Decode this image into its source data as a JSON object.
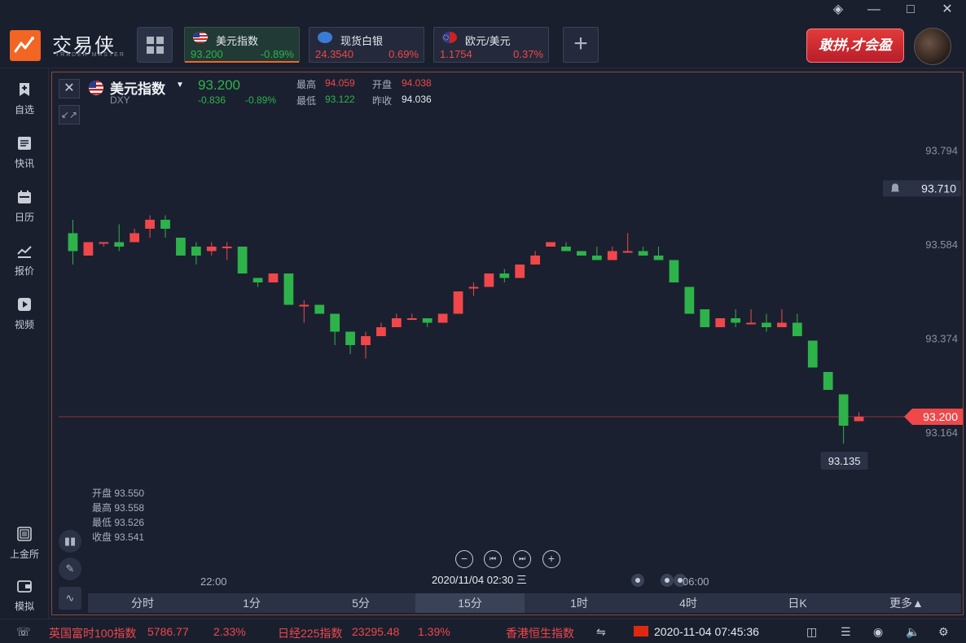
{
  "header": {
    "brand": "交易侠",
    "brand_sub": "TRADER MASTER",
    "promo": "敢拼,才会盈",
    "window_controls": [
      "layers-icon",
      "minimize-icon",
      "maximize-icon",
      "close-icon"
    ]
  },
  "tickers": [
    {
      "name": "美元指数",
      "price": "93.200",
      "change": "-0.89%",
      "direction": "down",
      "active": true
    },
    {
      "name": "现货白银",
      "price": "24.3540",
      "change": "0.69%",
      "direction": "up",
      "active": false
    },
    {
      "name": "欧元/美元",
      "price": "1.1754",
      "change": "0.37%",
      "direction": "up",
      "active": false
    }
  ],
  "sidebar": {
    "items": [
      {
        "label": "自选",
        "icon": "bookmark-plus-icon"
      },
      {
        "label": "快讯",
        "icon": "news-icon"
      },
      {
        "label": "日历",
        "icon": "calendar-icon"
      },
      {
        "label": "报价",
        "icon": "quote-chart-icon"
      },
      {
        "label": "视频",
        "icon": "video-icon"
      }
    ],
    "bottom_items": [
      {
        "label": "上金所",
        "icon": "sge-icon"
      },
      {
        "label": "模拟",
        "icon": "wallet-icon"
      }
    ]
  },
  "symbol": {
    "name": "美元指数",
    "code": "DXY",
    "price": "93.200",
    "change": "-0.836",
    "change_pct": "-0.89%",
    "high_label": "最高",
    "high": "94.059",
    "open_label": "开盘",
    "open": "94.038",
    "low_label": "最低",
    "low": "93.122",
    "prev_label": "昨收",
    "prev_close": "94.036"
  },
  "ohlc_hover": {
    "open": "开盘 93.550",
    "high": "最高 93.558",
    "low": "最低 93.526",
    "close": "收盘 93.541"
  },
  "colors": {
    "up": "#f0474a",
    "down": "#2db34a",
    "accent": "#f26522"
  },
  "chart_data": {
    "type": "candlestick",
    "y_axis_ticks": [
      "93.794",
      "93.584",
      "93.374",
      "93.164"
    ],
    "alert_price": "93.710",
    "last_price": "93.200",
    "low_marker": "93.135",
    "ylim": [
      93.06,
      93.86
    ],
    "x_labels": [
      "22:00",
      "06:00"
    ],
    "cursor_time": "2020/11/04 02:30 三",
    "candles": [
      {
        "o": 93.61,
        "h": 93.64,
        "l": 93.54,
        "c": 93.57
      },
      {
        "o": 93.56,
        "h": 93.59,
        "l": 93.56,
        "c": 93.59
      },
      {
        "o": 93.59,
        "h": 93.59,
        "l": 93.58,
        "c": 93.59
      },
      {
        "o": 93.59,
        "h": 93.63,
        "l": 93.57,
        "c": 93.58
      },
      {
        "o": 93.59,
        "h": 93.62,
        "l": 93.59,
        "c": 93.61
      },
      {
        "o": 93.62,
        "h": 93.65,
        "l": 93.6,
        "c": 93.64
      },
      {
        "o": 93.64,
        "h": 93.65,
        "l": 93.6,
        "c": 93.62
      },
      {
        "o": 93.6,
        "h": 93.6,
        "l": 93.56,
        "c": 93.56
      },
      {
        "o": 93.58,
        "h": 93.59,
        "l": 93.54,
        "c": 93.56
      },
      {
        "o": 93.57,
        "h": 93.59,
        "l": 93.56,
        "c": 93.58
      },
      {
        "o": 93.58,
        "h": 93.59,
        "l": 93.55,
        "c": 93.58
      },
      {
        "o": 93.58,
        "h": 93.58,
        "l": 93.52,
        "c": 93.52
      },
      {
        "o": 93.51,
        "h": 93.51,
        "l": 93.49,
        "c": 93.5
      },
      {
        "o": 93.5,
        "h": 93.52,
        "l": 93.5,
        "c": 93.52
      },
      {
        "o": 93.52,
        "h": 93.52,
        "l": 93.45,
        "c": 93.45
      },
      {
        "o": 93.45,
        "h": 93.46,
        "l": 93.41,
        "c": 93.45
      },
      {
        "o": 93.45,
        "h": 93.45,
        "l": 93.43,
        "c": 93.43
      },
      {
        "o": 93.43,
        "h": 93.43,
        "l": 93.36,
        "c": 93.39
      },
      {
        "o": 93.39,
        "h": 93.39,
        "l": 93.34,
        "c": 93.36
      },
      {
        "o": 93.36,
        "h": 93.39,
        "l": 93.33,
        "c": 93.38
      },
      {
        "o": 93.38,
        "h": 93.41,
        "l": 93.38,
        "c": 93.4
      },
      {
        "o": 93.4,
        "h": 93.43,
        "l": 93.4,
        "c": 93.42
      },
      {
        "o": 93.42,
        "h": 93.43,
        "l": 93.42,
        "c": 93.42
      },
      {
        "o": 93.42,
        "h": 93.42,
        "l": 93.4,
        "c": 93.41
      },
      {
        "o": 93.41,
        "h": 93.43,
        "l": 93.41,
        "c": 93.43
      },
      {
        "o": 93.43,
        "h": 93.48,
        "l": 93.43,
        "c": 93.48
      },
      {
        "o": 93.49,
        "h": 93.5,
        "l": 93.47,
        "c": 93.49
      },
      {
        "o": 93.49,
        "h": 93.52,
        "l": 93.49,
        "c": 93.52
      },
      {
        "o": 93.52,
        "h": 93.53,
        "l": 93.5,
        "c": 93.51
      },
      {
        "o": 93.51,
        "h": 93.54,
        "l": 93.51,
        "c": 93.54
      },
      {
        "o": 93.54,
        "h": 93.57,
        "l": 93.54,
        "c": 93.56
      },
      {
        "o": 93.58,
        "h": 93.59,
        "l": 93.58,
        "c": 93.59
      },
      {
        "o": 93.58,
        "h": 93.59,
        "l": 93.57,
        "c": 93.57
      },
      {
        "o": 93.57,
        "h": 93.57,
        "l": 93.56,
        "c": 93.56
      },
      {
        "o": 93.56,
        "h": 93.58,
        "l": 93.55,
        "c": 93.55
      },
      {
        "o": 93.55,
        "h": 93.58,
        "l": 93.55,
        "c": 93.57
      },
      {
        "o": 93.57,
        "h": 93.61,
        "l": 93.57,
        "c": 93.57
      },
      {
        "o": 93.57,
        "h": 93.58,
        "l": 93.56,
        "c": 93.56
      },
      {
        "o": 93.56,
        "h": 93.58,
        "l": 93.55,
        "c": 93.55
      },
      {
        "o": 93.55,
        "h": 93.55,
        "l": 93.5,
        "c": 93.5
      },
      {
        "o": 93.49,
        "h": 93.49,
        "l": 93.43,
        "c": 93.43
      },
      {
        "o": 93.44,
        "h": 93.44,
        "l": 93.4,
        "c": 93.4
      },
      {
        "o": 93.4,
        "h": 93.42,
        "l": 93.4,
        "c": 93.42
      },
      {
        "o": 93.42,
        "h": 93.44,
        "l": 93.4,
        "c": 93.41
      },
      {
        "o": 93.41,
        "h": 93.44,
        "l": 93.41,
        "c": 93.41
      },
      {
        "o": 93.41,
        "h": 93.43,
        "l": 93.39,
        "c": 93.4
      },
      {
        "o": 93.4,
        "h": 93.44,
        "l": 93.4,
        "c": 93.41
      },
      {
        "o": 93.41,
        "h": 93.43,
        "l": 93.38,
        "c": 93.38
      },
      {
        "o": 93.37,
        "h": 93.37,
        "l": 93.31,
        "c": 93.31
      },
      {
        "o": 93.3,
        "h": 93.3,
        "l": 93.26,
        "c": 93.26
      },
      {
        "o": 93.25,
        "h": 93.25,
        "l": 93.14,
        "c": 93.18
      },
      {
        "o": 93.19,
        "h": 93.21,
        "l": 93.19,
        "c": 93.2
      }
    ]
  },
  "controls": {
    "zoom_out": "−",
    "prev": "⏮",
    "next": "⏭",
    "zoom_in": "+"
  },
  "timeframes": [
    "分时",
    "1分",
    "5分",
    "15分",
    "1时",
    "4时",
    "日K",
    "更多▲"
  ],
  "selected_timeframe": "15分",
  "statusbar": {
    "items": [
      {
        "name": "英国富时100指数",
        "value": "5786.77",
        "change": "2.33%"
      },
      {
        "name": "日经225指数",
        "value": "23295.48",
        "change": "1.39%"
      },
      {
        "name": "香港恒生指数",
        "value": "",
        "change": ""
      }
    ],
    "datetime": "2020-11-04 07:45:36"
  }
}
